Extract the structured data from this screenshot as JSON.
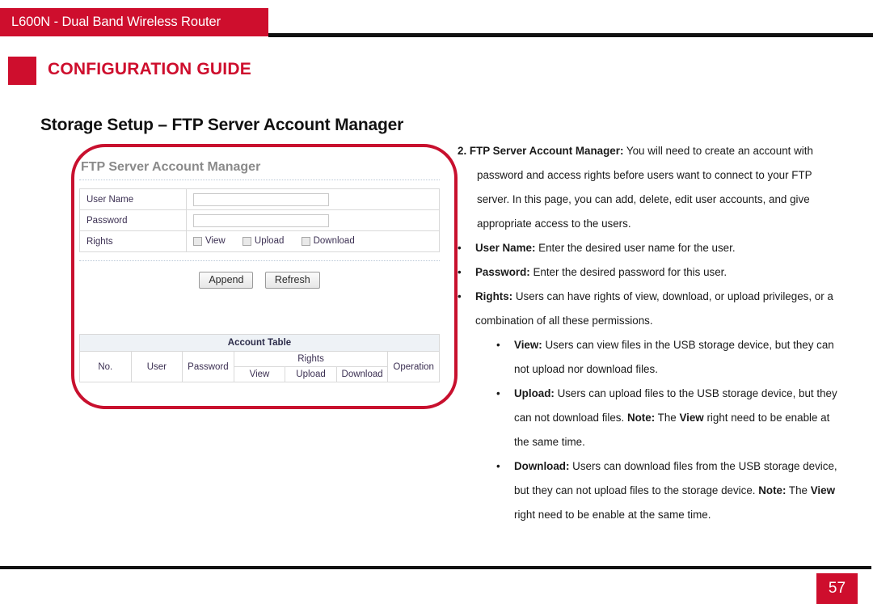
{
  "header": {
    "product_title": "L600N - Dual Band Wireless Router",
    "section_label": "CONFIGURATION GUIDE",
    "brand_red": "#CE0E2D"
  },
  "page": {
    "heading": "Storage Setup – FTP Server Account Manager",
    "number": "57"
  },
  "screenshot": {
    "panel_title": "FTP Server Account Manager",
    "form": {
      "rows": [
        {
          "label": "User Name",
          "type": "textbox",
          "value": ""
        },
        {
          "label": "Password",
          "type": "textbox",
          "value": ""
        },
        {
          "label": "Rights",
          "type": "checkboxes"
        }
      ],
      "checkboxes": [
        {
          "label": "View",
          "checked": false
        },
        {
          "label": "Upload",
          "checked": false
        },
        {
          "label": "Download",
          "checked": false
        }
      ]
    },
    "buttons": [
      {
        "label": "Append"
      },
      {
        "label": "Refresh"
      }
    ],
    "account_table": {
      "caption": "Account Table",
      "columns": {
        "no": "No.",
        "user": "User",
        "password": "Password",
        "rights": "Rights",
        "rights_sub": [
          "View",
          "Upload",
          "Download"
        ],
        "operation": "Operation"
      },
      "rows": []
    }
  },
  "content": {
    "item2": {
      "number": "2.",
      "term": "FTP Server Account Manager:",
      "text": " You will need to create an account with password and access rights before users want to connect to your FTP server. In this page, you can add, delete, edit user accounts, and give appropriate access to the users."
    },
    "bullets": [
      {
        "bullet": "•",
        "term": "User Name:",
        "text": " Enter the desired user name for the user."
      },
      {
        "bullet": "•",
        "term": "Password:",
        "text": " Enter the desired password for this user."
      },
      {
        "bullet": "•",
        "term": "Rights:",
        "text": " Users can have rights of view, download, or upload privileges, or a combination of all these permissions."
      }
    ],
    "sub_bullets": [
      {
        "bullet": "•",
        "term": "View:",
        "text": " Users can view files in the USB storage device, but they can not upload nor download files."
      },
      {
        "bullet": "•",
        "term": "Upload:",
        "text": " Users can upload files to the USB storage device, but they can not download files. ",
        "note_label": "Note:",
        "note_text": " The ",
        "note_term": "View",
        "note_tail": " right need to be enable at the same time."
      },
      {
        "bullet": "•",
        "term": "Download:",
        "text": " Users can download files from the USB storage device, but they can not upload files to the storage device. ",
        "note_label": "Note:",
        "note_text": " The ",
        "note_term": "View",
        "note_tail": " right need to be enable at the same time."
      }
    ]
  }
}
